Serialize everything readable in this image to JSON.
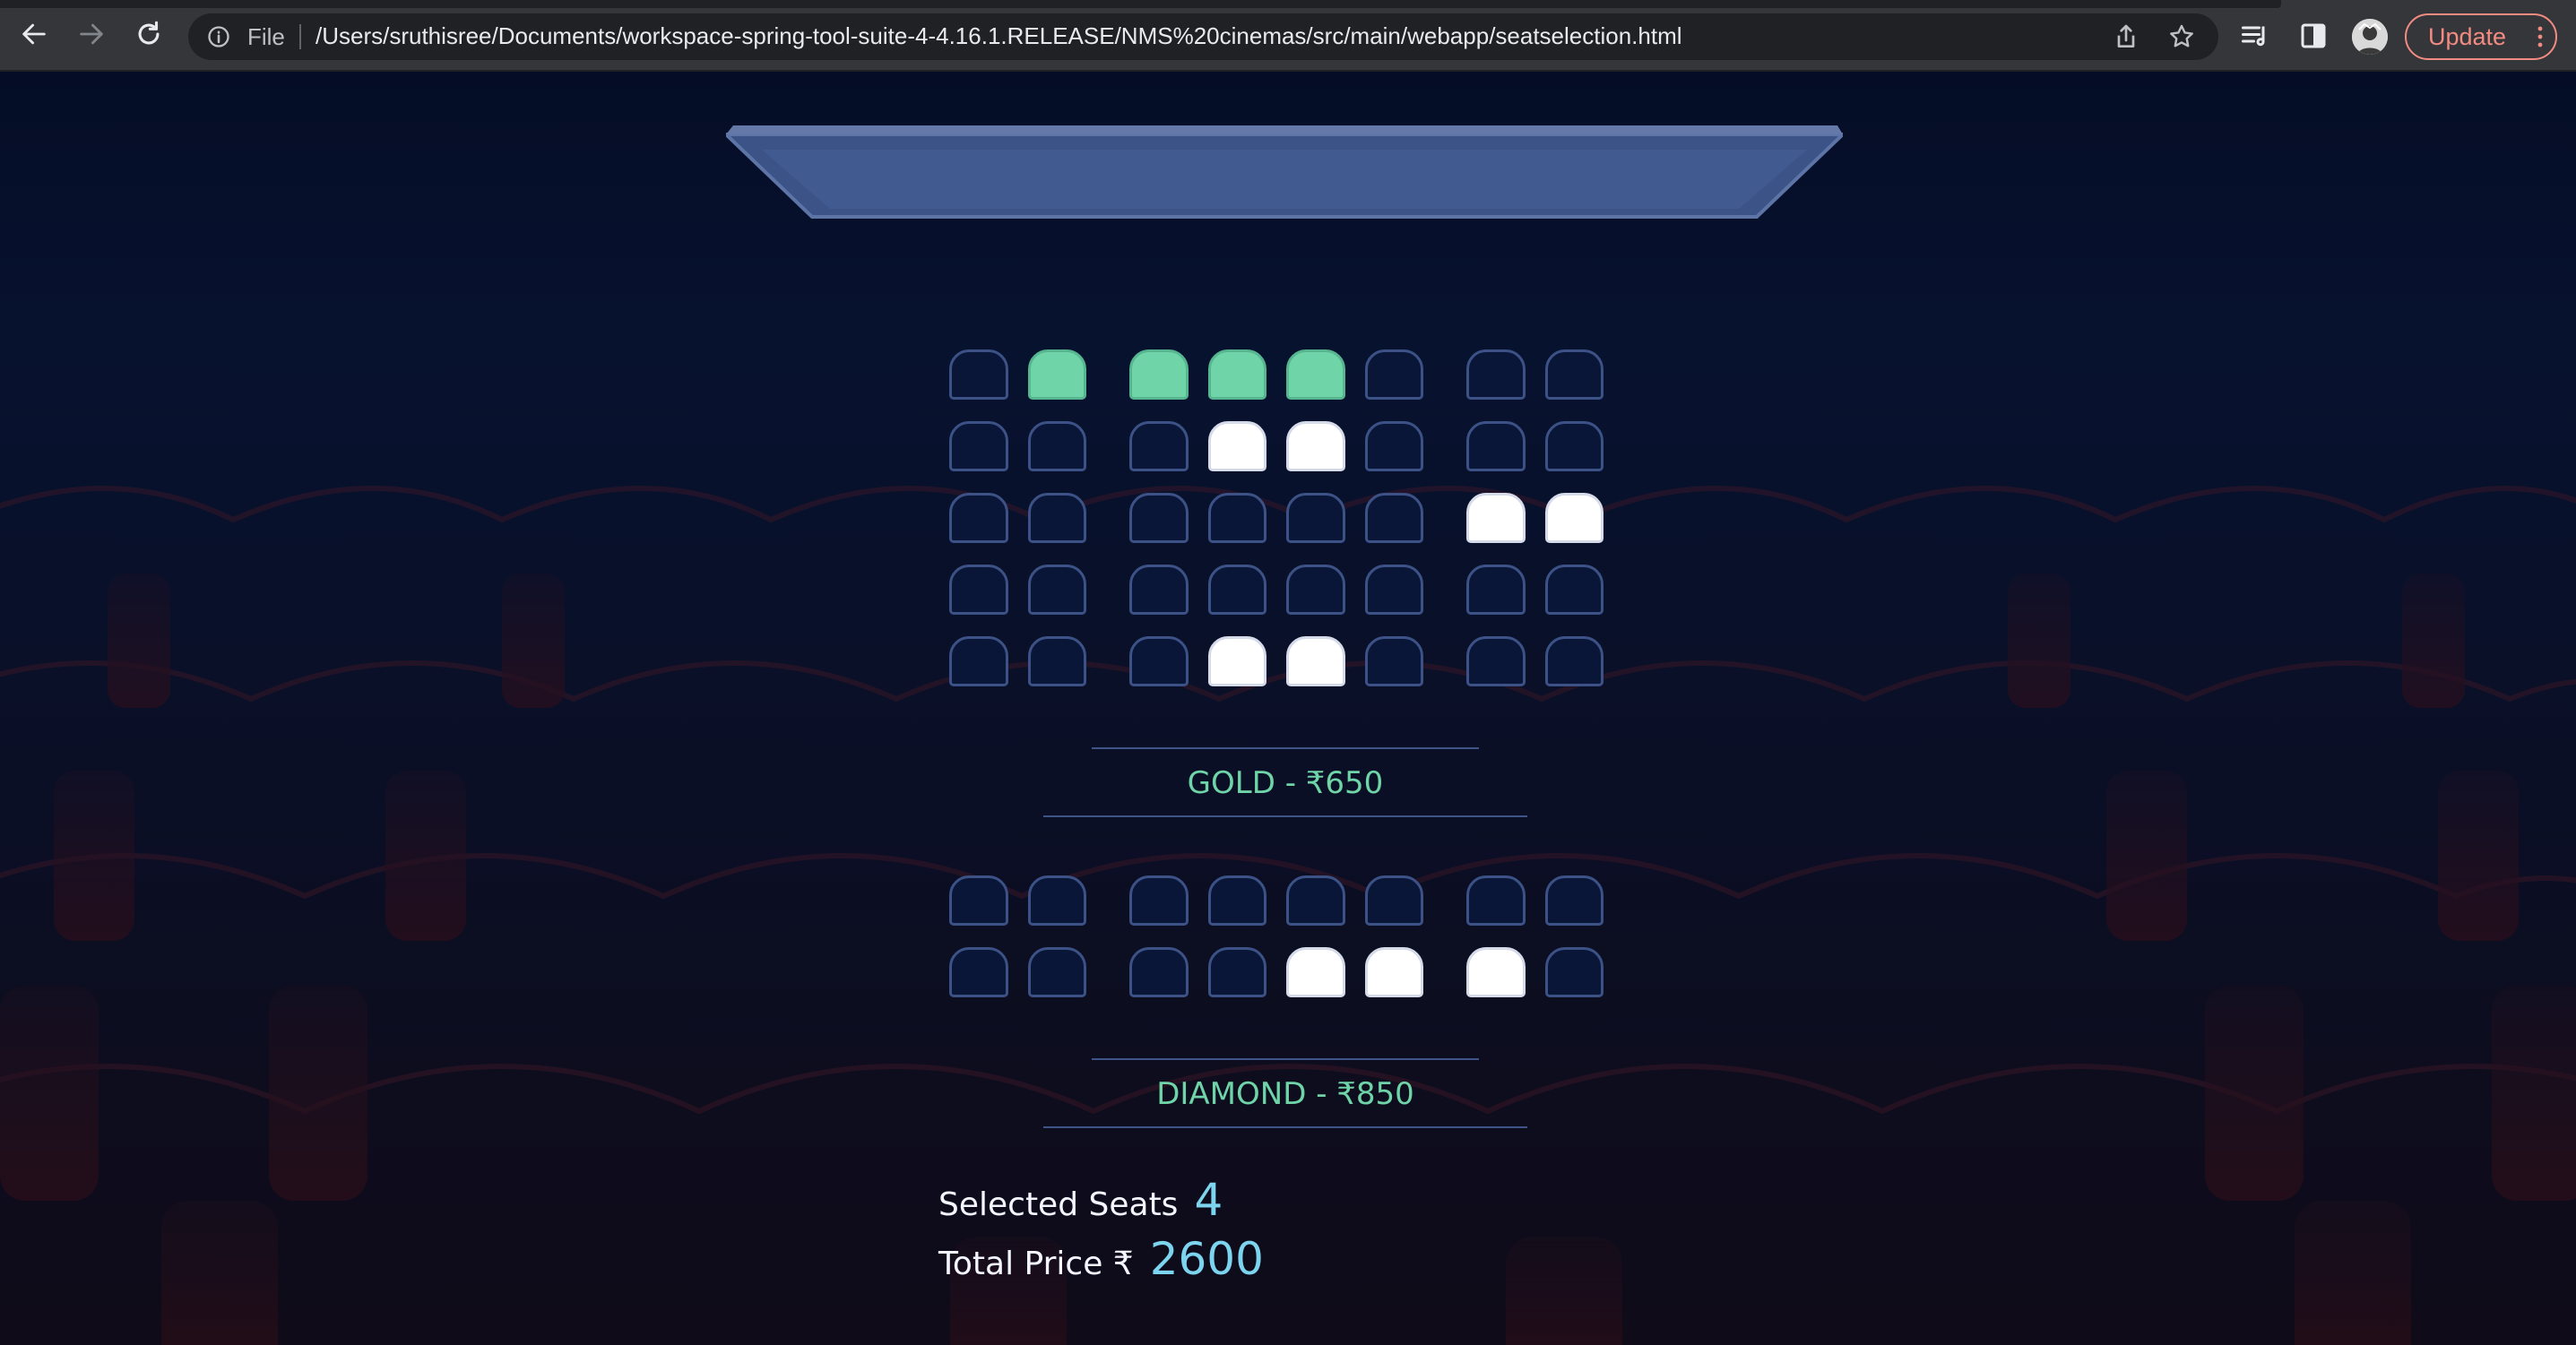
{
  "browser": {
    "scheme_label": "File",
    "url": "/Users/sruthisree/Documents/workspace-spring-tool-suite-4-4.16.1.RELEASE/NMS%20cinemas/src/main/webapp/seatselection.html",
    "update_label": "Update",
    "accent_color": "#f28b82"
  },
  "theatre": {
    "gold_label": "GOLD - ₹650",
    "diamond_label": "DIAMOND - ₹850",
    "gold_rows": [
      [
        "empty",
        "selected",
        "selected",
        "selected",
        "selected",
        "empty",
        "empty",
        "empty"
      ],
      [
        "empty",
        "empty",
        "empty",
        "occupied",
        "occupied",
        "empty",
        "empty",
        "empty"
      ],
      [
        "empty",
        "empty",
        "empty",
        "empty",
        "empty",
        "empty",
        "occupied",
        "occupied"
      ],
      [
        "empty",
        "empty",
        "empty",
        "empty",
        "empty",
        "empty",
        "empty",
        "empty"
      ],
      [
        "empty",
        "empty",
        "empty",
        "occupied",
        "occupied",
        "empty",
        "empty",
        "empty"
      ]
    ],
    "diamond_rows": [
      [
        "empty",
        "empty",
        "empty",
        "empty",
        "empty",
        "empty",
        "empty",
        "empty"
      ],
      [
        "empty",
        "empty",
        "empty",
        "empty",
        "occupied",
        "occupied",
        "occupied",
        "empty"
      ]
    ],
    "colors": {
      "selected": "#6fd4a8",
      "occupied": "#ffffff",
      "empty": "#0a1637"
    }
  },
  "summary": {
    "selected_label": "Selected Seats",
    "selected_count": "4",
    "price_label": "Total Price ₹",
    "total_price": "2600"
  }
}
